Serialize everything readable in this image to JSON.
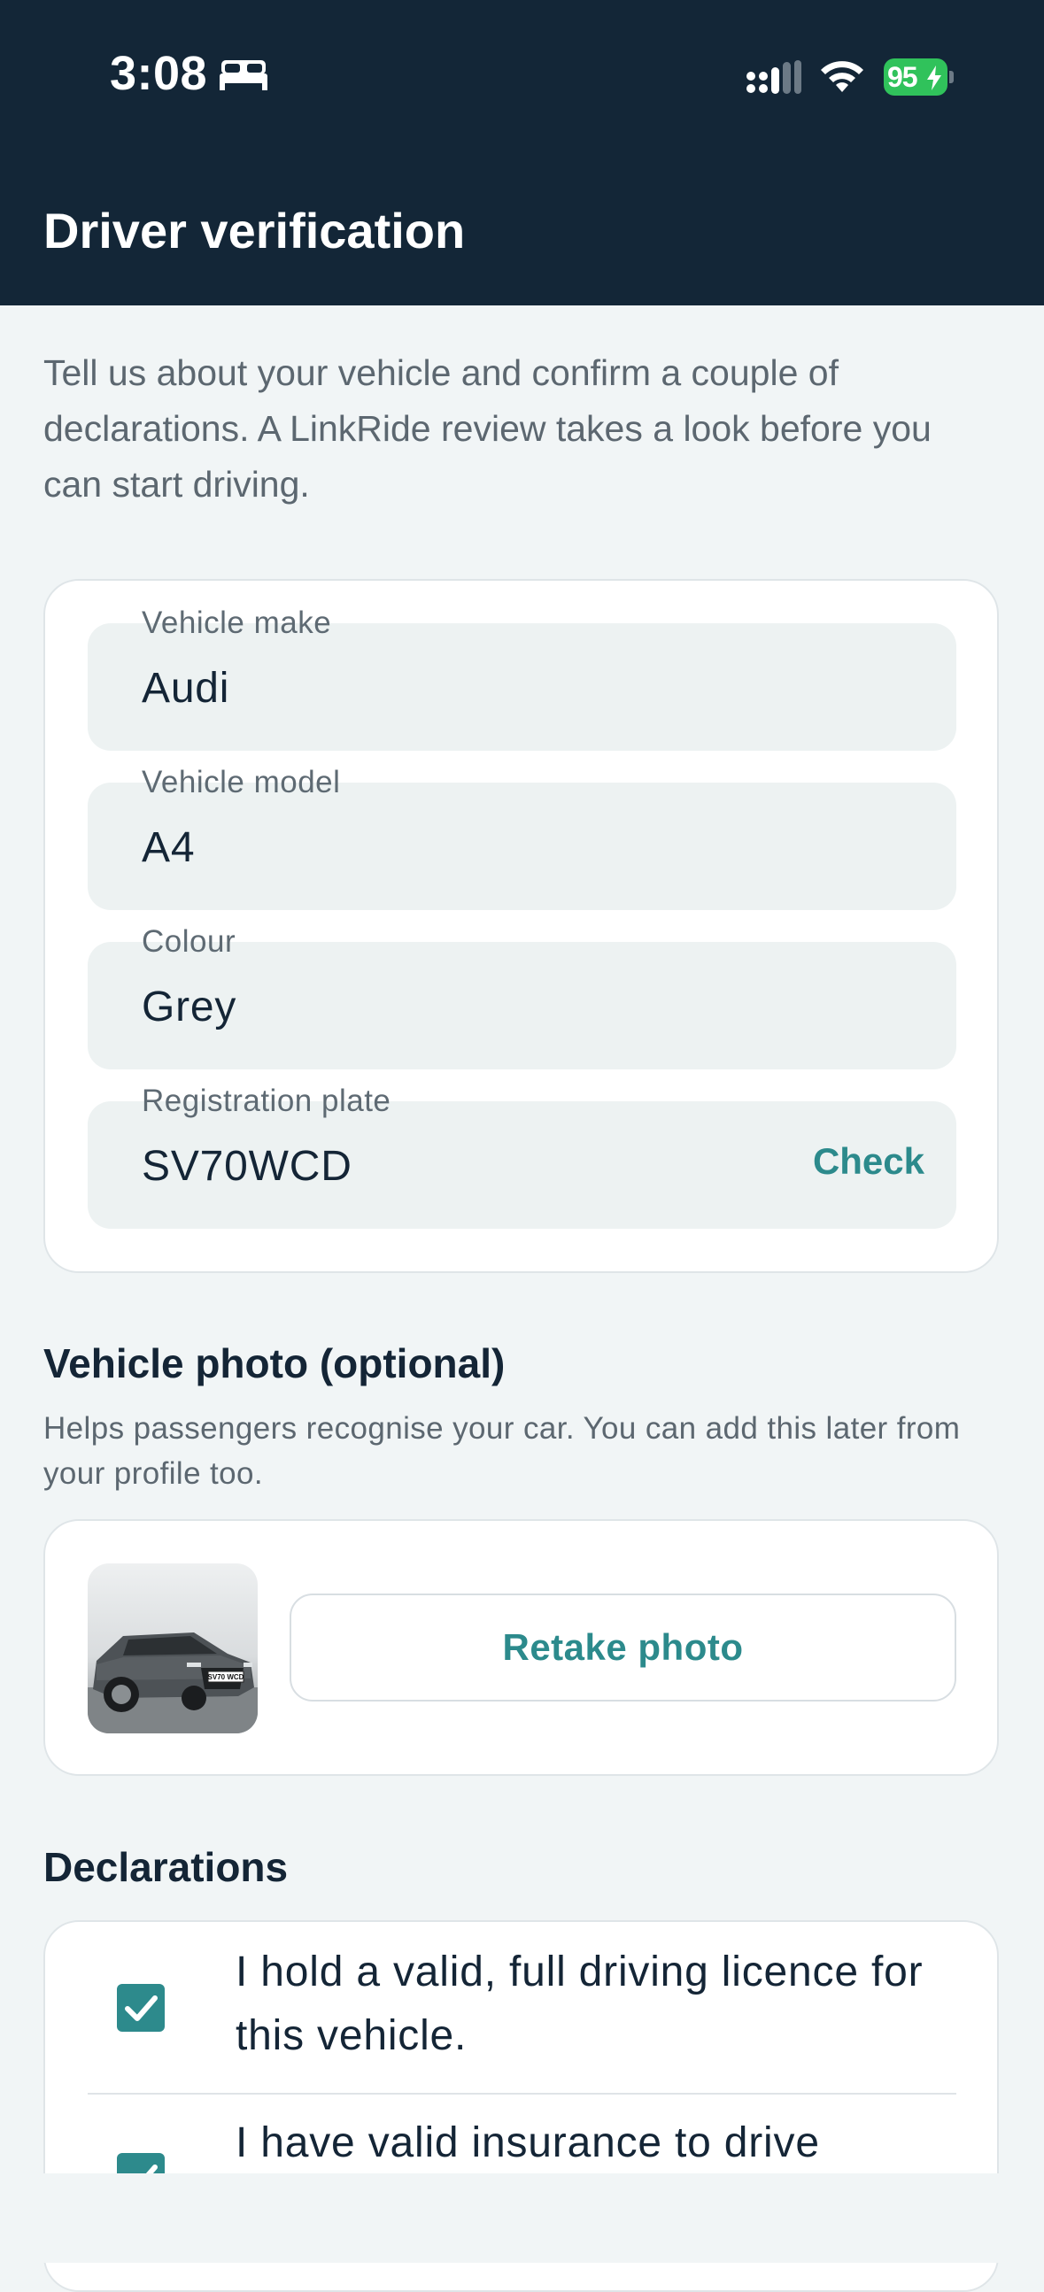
{
  "status_bar": {
    "time": "3:08",
    "battery": "95"
  },
  "header": {
    "title": "Driver verification"
  },
  "intro": "Tell us about your vehicle and confirm a couple of declarations. A LinkRide review takes a look before you can start driving.",
  "vehicle_form": {
    "make": {
      "label": "Vehicle make",
      "value": "Audi"
    },
    "model": {
      "label": "Vehicle model",
      "value": "A4"
    },
    "colour": {
      "label": "Colour",
      "value": "Grey"
    },
    "plate": {
      "label": "Registration plate",
      "value": "SV70WCD",
      "action": "Check"
    }
  },
  "photo": {
    "heading": "Vehicle photo (optional)",
    "subtext": "Helps passengers recognise your car. You can add this later from your profile too.",
    "retake_label": "Retake photo",
    "plate_text": "SV70 WCD"
  },
  "declarations": {
    "heading": "Declarations",
    "items": [
      {
        "text": "I hold a valid, full driving licence for this vehicle.",
        "checked": true
      },
      {
        "text": "I have valid insurance to drive",
        "checked": true
      }
    ]
  },
  "colors": {
    "header_bg": "#132637",
    "accent": "#2c8a8c",
    "page_bg": "#f1f5f6",
    "battery": "#30c25b"
  },
  "icons": {
    "bed": "bed-icon",
    "signal": "cellular-signal-icon",
    "wifi": "wifi-icon",
    "bolt": "charging-bolt-icon",
    "check": "checkmark-icon"
  }
}
